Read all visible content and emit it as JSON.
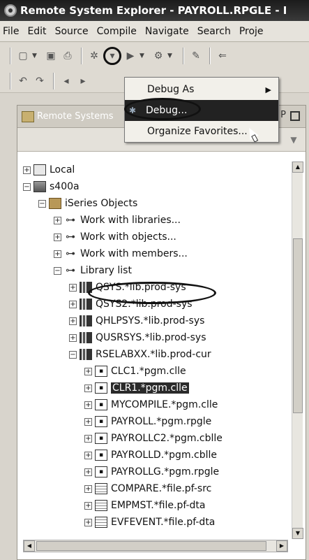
{
  "window": {
    "title": "Remote System Explorer - PAYROLL.RPGLE - I"
  },
  "menubar": [
    "File",
    "Edit",
    "Source",
    "Compile",
    "Navigate",
    "Search",
    "Proje"
  ],
  "panel": {
    "title": "Remote Systems"
  },
  "dropdown": {
    "items": [
      {
        "label": "Debug As",
        "has_submenu": true
      },
      {
        "label": "Debug...",
        "selected": true
      },
      {
        "label": "Organize Favorites..."
      }
    ]
  },
  "tree": [
    {
      "label": "Local",
      "icon": "host-icon",
      "depth": 0,
      "expander": "+"
    },
    {
      "label": "s400a",
      "icon": "server-icon",
      "depth": 0,
      "expander": "-"
    },
    {
      "label": "iSeries Objects",
      "icon": "folder-icon",
      "depth": 1,
      "expander": "-"
    },
    {
      "label": "Work with libraries...",
      "icon": "filter-icon",
      "depth": 2,
      "expander": "+"
    },
    {
      "label": "Work with objects...",
      "icon": "filter-icon",
      "depth": 2,
      "expander": "+"
    },
    {
      "label": "Work with members...",
      "icon": "filter-icon",
      "depth": 2,
      "expander": "+"
    },
    {
      "label": "Library list",
      "icon": "filter-icon",
      "depth": 2,
      "expander": "-"
    },
    {
      "label": "QSYS.*lib.prod-sys",
      "icon": "library-icon",
      "depth": 3,
      "expander": "+"
    },
    {
      "label": "QSYS2.*lib.prod-sys",
      "icon": "library-icon",
      "depth": 3,
      "expander": "+"
    },
    {
      "label": "QHLPSYS.*lib.prod-sys",
      "icon": "library-icon",
      "depth": 3,
      "expander": "+"
    },
    {
      "label": "QUSRSYS.*lib.prod-sys",
      "icon": "library-icon",
      "depth": 3,
      "expander": "+"
    },
    {
      "label": "RSELABXX.*lib.prod-cur",
      "icon": "library-icon",
      "depth": 3,
      "expander": "-"
    },
    {
      "label": "CLC1.*pgm.clle",
      "icon": "program-icon",
      "depth": 4,
      "expander": "+"
    },
    {
      "label": "CLR1.*pgm.clle",
      "icon": "program-icon",
      "depth": 4,
      "expander": "+",
      "selected": true
    },
    {
      "label": "MYCOMPILE.*pgm.clle",
      "icon": "program-icon",
      "depth": 4,
      "expander": "+"
    },
    {
      "label": "PAYROLL.*pgm.rpgle",
      "icon": "program-icon",
      "depth": 4,
      "expander": "+"
    },
    {
      "label": "PAYROLLC2.*pgm.cblle",
      "icon": "program-icon",
      "depth": 4,
      "expander": "+"
    },
    {
      "label": "PAYROLLD.*pgm.cblle",
      "icon": "program-icon",
      "depth": 4,
      "expander": "+"
    },
    {
      "label": "PAYROLLG.*pgm.rpgle",
      "icon": "program-icon",
      "depth": 4,
      "expander": "+"
    },
    {
      "label": "COMPARE.*file.pf-src",
      "icon": "file-icon",
      "depth": 4,
      "expander": "+"
    },
    {
      "label": "EMPMST.*file.pf-dta",
      "icon": "file-icon",
      "depth": 4,
      "expander": "+"
    },
    {
      "label": "EVFEVENT.*file.pf-dta",
      "icon": "file-icon",
      "depth": 4,
      "expander": "+"
    }
  ]
}
